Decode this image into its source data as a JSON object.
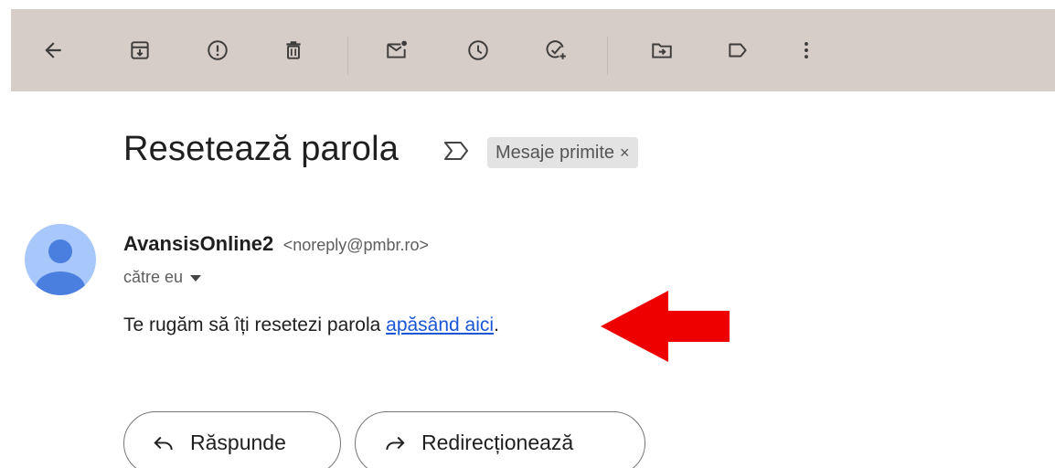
{
  "toolbar": {
    "items": [
      {
        "name": "back-icon"
      },
      {
        "name": "archive-icon"
      },
      {
        "name": "report-spam-icon"
      },
      {
        "name": "delete-icon"
      },
      {
        "name": "mark-unread-icon"
      },
      {
        "name": "snooze-icon"
      },
      {
        "name": "add-to-tasks-icon"
      },
      {
        "name": "move-to-icon"
      },
      {
        "name": "label-icon"
      },
      {
        "name": "more-options-icon"
      }
    ],
    "background": "#d6ccc8"
  },
  "email": {
    "subject": "Resetează parola",
    "label_chip": "Mesaje primite",
    "label_close": "×",
    "sender_name": "AvansisOnline2",
    "sender_email": "<noreply@pmbr.ro>",
    "recipient": "către eu",
    "body_prefix": "Te rugăm să îți resetezi parola ",
    "body_link": "apăsând aici",
    "body_suffix": "."
  },
  "actions": {
    "reply_label": "Răspunde",
    "forward_label": "Redirecționează"
  },
  "colors": {
    "link": "#1a56d6",
    "avatar_bg": "#a8c7fa",
    "avatar_fg": "#4a7fe0",
    "arrow": "#ee0000"
  }
}
